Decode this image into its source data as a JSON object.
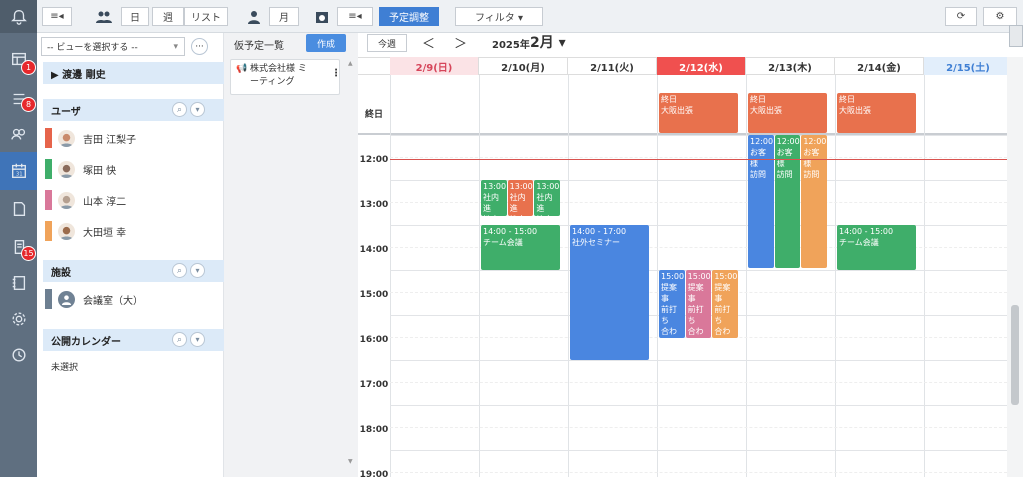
{
  "rail": {
    "badges": [
      "1",
      "8",
      "15"
    ]
  },
  "toolbar": {
    "day": "日",
    "week": "週",
    "list": "リスト",
    "month": "月",
    "adjust": "予定調整",
    "filter": "フィルタ ▾"
  },
  "left": {
    "view_select": "-- ビューを選択する --",
    "favorite": "▶ 渡邊 剛史",
    "users_title": "ユーザ",
    "users": [
      {
        "name": "吉田 江梨子",
        "color": "#e6644b"
      },
      {
        "name": "塚田 快",
        "color": "#3fae6a"
      },
      {
        "name": "山本 淳二",
        "color": "#d9789a"
      },
      {
        "name": "大田垣 幸",
        "color": "#f0a35a"
      }
    ],
    "facilities_title": "施設",
    "facility": {
      "name": "会議室（大）",
      "color": "#6d7f91"
    },
    "public_title": "公開カレンダー",
    "public_value": "未選択"
  },
  "tentative": {
    "title": "仮予定一覧",
    "create": "作成",
    "item": "株式会社様 ミ\nーティング"
  },
  "calendar": {
    "today": "今週",
    "prev": "＜",
    "next": "＞",
    "year": "2025年",
    "month": "2月 ▾",
    "days": [
      {
        "label": "2/9(日)",
        "type": "sun"
      },
      {
        "label": "2/10(月)",
        "type": "normal"
      },
      {
        "label": "2/11(火)",
        "type": "normal"
      },
      {
        "label": "2/12(水)",
        "type": "today"
      },
      {
        "label": "2/13(木)",
        "type": "normal"
      },
      {
        "label": "2/14(金)",
        "type": "normal"
      },
      {
        "label": "2/15(土)",
        "type": "sat"
      }
    ],
    "allday": "終日",
    "hours": [
      "12:00",
      "13:00",
      "14:00",
      "15:00",
      "16:00",
      "17:00",
      "18:00",
      "19:00"
    ],
    "allday_events": [
      {
        "day": 3,
        "text": "終日\n大阪出張"
      },
      {
        "day": 4,
        "text": "終日\n大阪出張"
      },
      {
        "day": 5,
        "text": "終日\n大阪出張"
      }
    ],
    "events": [
      {
        "day": 1,
        "col": 0,
        "cols": 3,
        "start": 13.0,
        "end": 13.8,
        "color": "#3fae6a",
        "text": "13:00\n社内進\n捗定例"
      },
      {
        "day": 1,
        "col": 1,
        "cols": 3,
        "start": 13.0,
        "end": 13.8,
        "color": "#e8714d",
        "text": "13:00\n社内進\n捗定例"
      },
      {
        "day": 1,
        "col": 2,
        "cols": 3,
        "start": 13.0,
        "end": 13.8,
        "color": "#3fae6a",
        "text": "13:00\n社内進\n捗定例"
      },
      {
        "day": 1,
        "col": 0,
        "cols": 1,
        "start": 14.0,
        "end": 15.0,
        "color": "#3fae6a",
        "text": "14:00 - 15:00\nチーム会議"
      },
      {
        "day": 2,
        "col": 0,
        "cols": 1,
        "start": 14.0,
        "end": 17.0,
        "color": "#4a86e0",
        "text": "14:00 - 17:00\n社外セミナー"
      },
      {
        "day": 3,
        "col": 0,
        "cols": 3,
        "start": 15.0,
        "end": 16.5,
        "color": "#4a86e0",
        "text": "15:00\n提案事\n前打ち\n合わせ"
      },
      {
        "day": 3,
        "col": 1,
        "cols": 3,
        "start": 15.0,
        "end": 16.5,
        "color": "#d9789a",
        "text": "15:00\n提案事\n前打ち\n合わせ"
      },
      {
        "day": 3,
        "col": 2,
        "cols": 3,
        "start": 15.0,
        "end": 16.5,
        "color": "#f0a35a",
        "text": "15:00\n提案事\n前打ち\n合わせ"
      },
      {
        "day": 4,
        "col": 0,
        "cols": 3,
        "start": 12.0,
        "end": 14.95,
        "color": "#4a86e0",
        "text": "12:00\nお客様\n訪問"
      },
      {
        "day": 4,
        "col": 1,
        "cols": 3,
        "start": 12.0,
        "end": 14.95,
        "color": "#3fae6a",
        "text": "12:00\nお客様\n訪問"
      },
      {
        "day": 4,
        "col": 2,
        "cols": 3,
        "start": 12.0,
        "end": 14.95,
        "color": "#f0a35a",
        "text": "12:00\nお客様\n訪問"
      },
      {
        "day": 5,
        "col": 0,
        "cols": 1,
        "start": 14.0,
        "end": 15.0,
        "color": "#3fae6a",
        "text": "14:00 - 15:00\nチーム会議"
      }
    ]
  }
}
